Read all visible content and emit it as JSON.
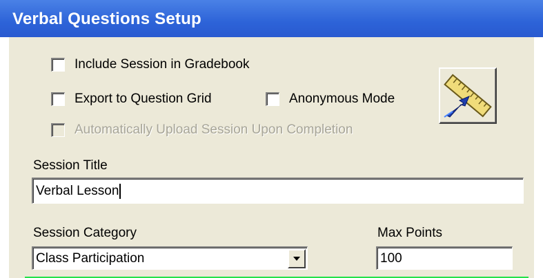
{
  "window": {
    "title": "Verbal Questions Setup"
  },
  "options": {
    "include_gradebook": {
      "label": "Include Session in Gradebook",
      "checked": false
    },
    "export_grid": {
      "label": "Export to Question Grid",
      "checked": false
    },
    "anonymous": {
      "label": "Anonymous Mode",
      "checked": false
    },
    "auto_upload": {
      "label": "Automatically Upload Session Upon Completion",
      "checked": false,
      "disabled": true
    }
  },
  "tool_button": {
    "icon": "ruler-pointer-icon"
  },
  "session_title": {
    "label": "Session Title",
    "value": "Verbal Lesson"
  },
  "session_category": {
    "label": "Session Category",
    "selected": "Class Participation"
  },
  "max_points": {
    "label": "Max Points",
    "value": "100"
  },
  "colors": {
    "titlebar": "#2d63d8",
    "panel": "#ece9d8",
    "accent_green": "#22e24a"
  }
}
